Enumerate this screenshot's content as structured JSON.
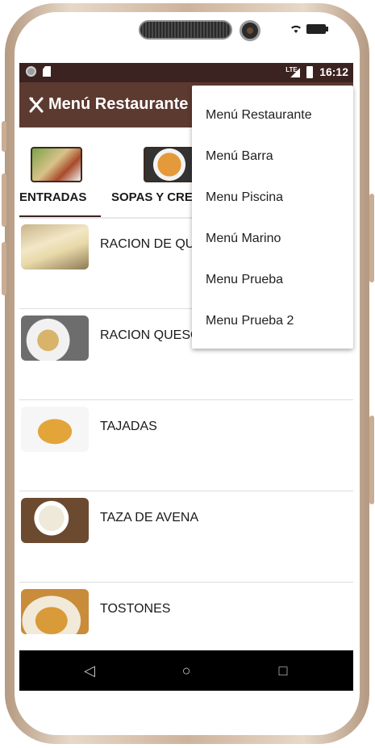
{
  "status_bar": {
    "time": "16:12",
    "network": "LTE",
    "icons": [
      "circle-icon",
      "sd-card-icon",
      "lte-signal-icon",
      "battery-icon"
    ]
  },
  "app_bar": {
    "icon": "cutlery-icon",
    "title": "Menú Restaurante"
  },
  "tabs": [
    {
      "label": "ENTRADAS",
      "selected": true,
      "image": "salad-thumbnail"
    },
    {
      "label": "SOPAS Y CRE",
      "selected": false,
      "image": "soup-thumbnail"
    }
  ],
  "items": [
    {
      "name": "RACION DE QU",
      "image": "cheese-photo"
    },
    {
      "name": "RACION QUESO",
      "image": "fried-cheese-photo"
    },
    {
      "name": "TAJADAS",
      "image": "plantain-slices-photo"
    },
    {
      "name": "TAZA DE AVENA",
      "image": "oatmeal-cup-photo"
    },
    {
      "name": "TOSTONES",
      "image": "tostones-photo"
    }
  ],
  "overflow_menu": {
    "items": [
      "Menú Restaurante",
      "Menú Barra",
      "Menu Piscina",
      "Menú Marino",
      "Menu Prueba",
      "Menu Prueba 2"
    ]
  },
  "nav_bar": {
    "back": "◁",
    "home": "○",
    "recents": "□"
  },
  "colors": {
    "status_bar": "#3a2320",
    "app_bar": "#5d3a30",
    "navbar": "#000000"
  }
}
